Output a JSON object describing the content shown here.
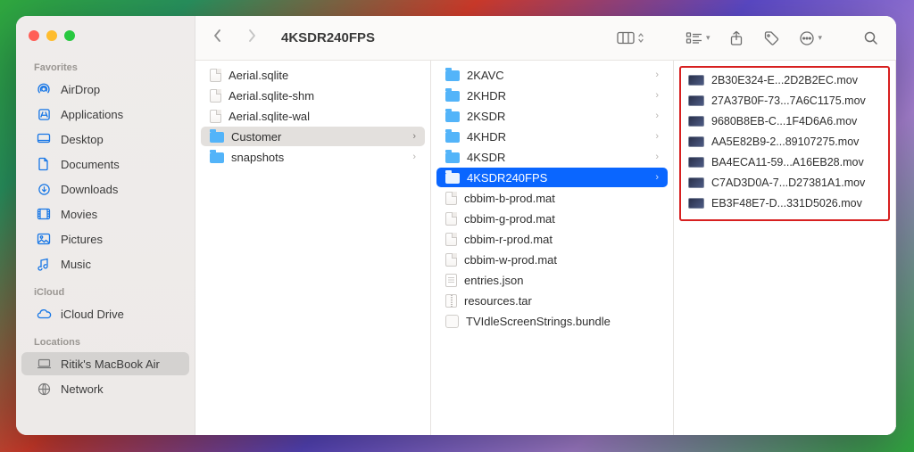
{
  "window": {
    "title": "4KSDR240FPS"
  },
  "sidebar": {
    "sections": [
      {
        "label": "Favorites",
        "items": [
          {
            "icon": "airdrop",
            "label": "AirDrop"
          },
          {
            "icon": "apps",
            "label": "Applications"
          },
          {
            "icon": "desktop",
            "label": "Desktop"
          },
          {
            "icon": "documents",
            "label": "Documents"
          },
          {
            "icon": "downloads",
            "label": "Downloads"
          },
          {
            "icon": "movies",
            "label": "Movies"
          },
          {
            "icon": "pictures",
            "label": "Pictures"
          },
          {
            "icon": "music",
            "label": "Music"
          }
        ]
      },
      {
        "label": "iCloud",
        "items": [
          {
            "icon": "icloud",
            "label": "iCloud Drive"
          }
        ]
      },
      {
        "label": "Locations",
        "items": [
          {
            "icon": "laptop",
            "label": "Ritik's MacBook Air",
            "selected": true,
            "gray": true
          },
          {
            "icon": "network",
            "label": "Network",
            "gray": true
          }
        ]
      }
    ]
  },
  "columns": {
    "c1": [
      {
        "type": "page",
        "name": "Aerial.sqlite"
      },
      {
        "type": "page",
        "name": "Aerial.sqlite-shm"
      },
      {
        "type": "page",
        "name": "Aerial.sqlite-wal"
      },
      {
        "type": "folder",
        "name": "Customer",
        "chevron": true,
        "selected": true
      },
      {
        "type": "folder",
        "name": "snapshots",
        "chevron": true
      }
    ],
    "c2": [
      {
        "type": "folder",
        "name": "2KAVC",
        "chevron": true
      },
      {
        "type": "folder",
        "name": "2KHDR",
        "chevron": true
      },
      {
        "type": "folder",
        "name": "2KSDR",
        "chevron": true
      },
      {
        "type": "folder",
        "name": "4KHDR",
        "chevron": true
      },
      {
        "type": "folder",
        "name": "4KSDR",
        "chevron": true
      },
      {
        "type": "folder",
        "name": "4KSDR240FPS",
        "chevron": true,
        "selected": true
      },
      {
        "type": "page",
        "name": "cbbim-b-prod.mat"
      },
      {
        "type": "page",
        "name": "cbbim-g-prod.mat"
      },
      {
        "type": "page",
        "name": "cbbim-r-prod.mat"
      },
      {
        "type": "page",
        "name": "cbbim-w-prod.mat"
      },
      {
        "type": "json",
        "name": "entries.json"
      },
      {
        "type": "archive",
        "name": "resources.tar"
      },
      {
        "type": "bundle",
        "name": "TVIdleScreenStrings.bundle"
      }
    ],
    "c3": [
      {
        "name": "2B30E324-E...2D2B2EC.mov"
      },
      {
        "name": "27A37B0F-73...7A6C1175.mov"
      },
      {
        "name": "9680B8EB-C...1F4D6A6.mov"
      },
      {
        "name": "AA5E82B9-2...89107275.mov"
      },
      {
        "name": "BA4ECA11-59...A16EB28.mov"
      },
      {
        "name": "C7AD3D0A-7...D27381A1.mov"
      },
      {
        "name": "EB3F48E7-D...331D5026.mov"
      }
    ]
  }
}
